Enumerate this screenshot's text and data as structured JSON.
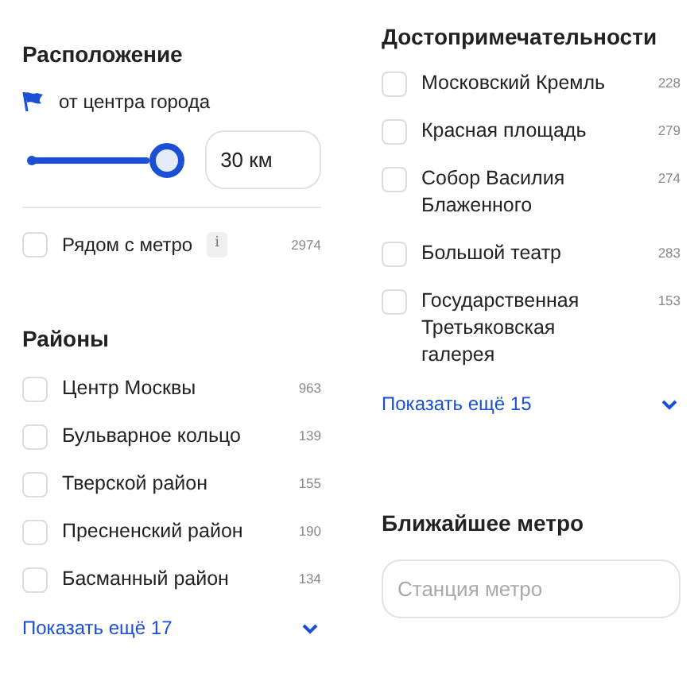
{
  "location": {
    "title": "Расположение",
    "from_label": "от центра города",
    "distance": {
      "value": "30 км"
    },
    "near_metro": {
      "label": "Рядом с метро",
      "info": "i",
      "count": "2974",
      "checked": false
    }
  },
  "districts": {
    "title": "Районы",
    "items": [
      {
        "label": "Центр Москвы",
        "count": "963",
        "checked": false
      },
      {
        "label": "Бульварное кольцо",
        "count": "139",
        "checked": false
      },
      {
        "label": "Тверской район",
        "count": "155",
        "checked": false
      },
      {
        "label": "Пресненский район",
        "count": "190",
        "checked": false
      },
      {
        "label": "Басманный район",
        "count": "134",
        "checked": false
      }
    ],
    "show_more": "Показать ещё 17"
  },
  "landmarks": {
    "title": "Достопримечательности",
    "items": [
      {
        "label": "Московский Кремль",
        "count": "228",
        "checked": false
      },
      {
        "label": "Красная площадь",
        "count": "279",
        "checked": false
      },
      {
        "label": "Собор Василия Блаженного",
        "count": "274",
        "checked": false
      },
      {
        "label": "Большой театр",
        "count": "283",
        "checked": false
      },
      {
        "label": "Государственная Третьяковская галерея",
        "count": "153",
        "checked": false
      }
    ],
    "show_more": "Показать ещё 15"
  },
  "nearest_metro": {
    "title": "Ближайшее метро",
    "placeholder": "Станция метро"
  }
}
